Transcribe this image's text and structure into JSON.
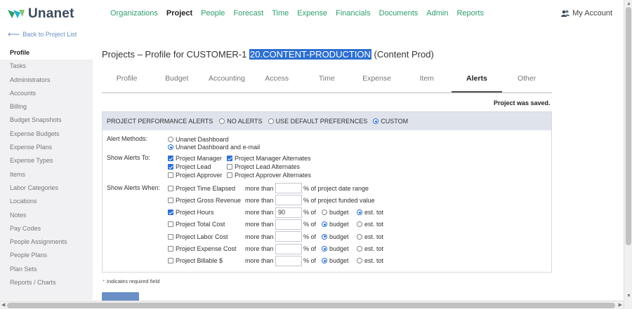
{
  "app": {
    "logo_text": "Unanet"
  },
  "nav": {
    "items": [
      "Organizations",
      "Project",
      "People",
      "Forecast",
      "Time",
      "Expense",
      "Financials",
      "Documents",
      "Admin",
      "Reports"
    ],
    "active": "Project",
    "account_label": "My Account"
  },
  "back_link": "Back to Project List",
  "sidebar": {
    "items": [
      "Profile",
      "Tasks",
      "Administrators",
      "Accounts",
      "Billing",
      "Budget Snapshots",
      "Expense Budgets",
      "Expense Plans",
      "Expense Types",
      "Items",
      "Labor Categories",
      "Locations",
      "Notes",
      "Pay Codes",
      "People Assignments",
      "People Plans",
      "Plan Sets",
      "Reports / Charts"
    ],
    "active": "Profile"
  },
  "title": {
    "prefix": "Projects – Profile for CUSTOMER-1",
    "highlighted": "20.CONTENT-PRODUCTION",
    "suffix": "(Content Prod)"
  },
  "tabs": {
    "items": [
      "Profile",
      "Budget",
      "Accounting",
      "Access",
      "Time",
      "Expense",
      "Item",
      "Alerts",
      "Other"
    ],
    "active": "Alerts"
  },
  "status_message": "Project was saved.",
  "alerts": {
    "header_label": "PROJECT PERFORMANCE ALERTS",
    "modes": [
      {
        "label": "NO ALERTS",
        "selected": false
      },
      {
        "label": "USE DEFAULT PREFERENCES",
        "selected": false
      },
      {
        "label": "CUSTOM",
        "selected": true
      }
    ],
    "methods_label": "Alert Methods:",
    "methods": [
      {
        "label": "Unanet Dashboard",
        "selected": false
      },
      {
        "label": "Unanet Dashboard and e-mail",
        "selected": true
      }
    ],
    "show_to_label": "Show Alerts To:",
    "recipients": [
      {
        "label": "Project Manager",
        "checked": true
      },
      {
        "label": "Project Manager Alternates",
        "checked": true
      },
      {
        "label": "Project Lead",
        "checked": true
      },
      {
        "label": "Project Lead Alternates",
        "checked": false
      },
      {
        "label": "Project Approver",
        "checked": false
      },
      {
        "label": "Project Approver Alternates",
        "checked": false
      }
    ],
    "show_when_label": "Show Alerts When:",
    "more_than_label": "more than",
    "pct_of_label": "% of",
    "budget_label": "budget",
    "est_label": "est. tot",
    "conditions": [
      {
        "label": "Project Time Elapsed",
        "checked": false,
        "value": "",
        "tail": "% of project date range",
        "basis": null
      },
      {
        "label": "Project Gross Revenue",
        "checked": false,
        "value": "",
        "tail": "% of project funded value",
        "basis": null
      },
      {
        "label": "Project Hours",
        "checked": true,
        "value": "90",
        "tail": null,
        "basis": "est"
      },
      {
        "label": "Project Total Cost",
        "checked": false,
        "value": "",
        "tail": null,
        "basis": "budget"
      },
      {
        "label": "Project Labor Cost",
        "checked": false,
        "value": "",
        "tail": null,
        "basis": "budget"
      },
      {
        "label": "Project Expense Cost",
        "checked": false,
        "value": "",
        "tail": null,
        "basis": "budget"
      },
      {
        "label": "Project Billable $",
        "checked": false,
        "value": "",
        "tail": null,
        "basis": "budget"
      }
    ]
  },
  "required_note": "Indicates required field"
}
